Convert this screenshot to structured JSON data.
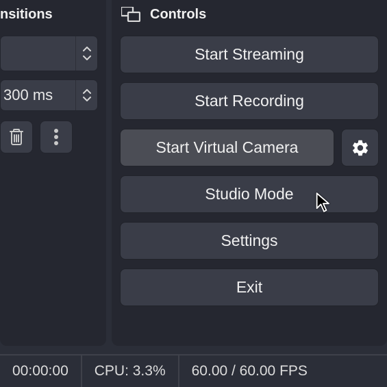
{
  "left_panel": {
    "title": "Scene Transitions",
    "title_visible": "nsitions",
    "dropdown_value": "",
    "duration_value": "300 ms",
    "duration_visible": "300 ms"
  },
  "controls_panel": {
    "title": "Controls",
    "buttons": {
      "start_streaming": "Start Streaming",
      "start_recording": "Start Recording",
      "start_virtual_camera": "Start Virtual Camera",
      "studio_mode": "Studio Mode",
      "settings": "Settings",
      "exit": "Exit"
    }
  },
  "statusbar": {
    "time": "00:00:00",
    "cpu": "CPU: 3.3%",
    "fps": "60.00 / 60.00 FPS"
  }
}
